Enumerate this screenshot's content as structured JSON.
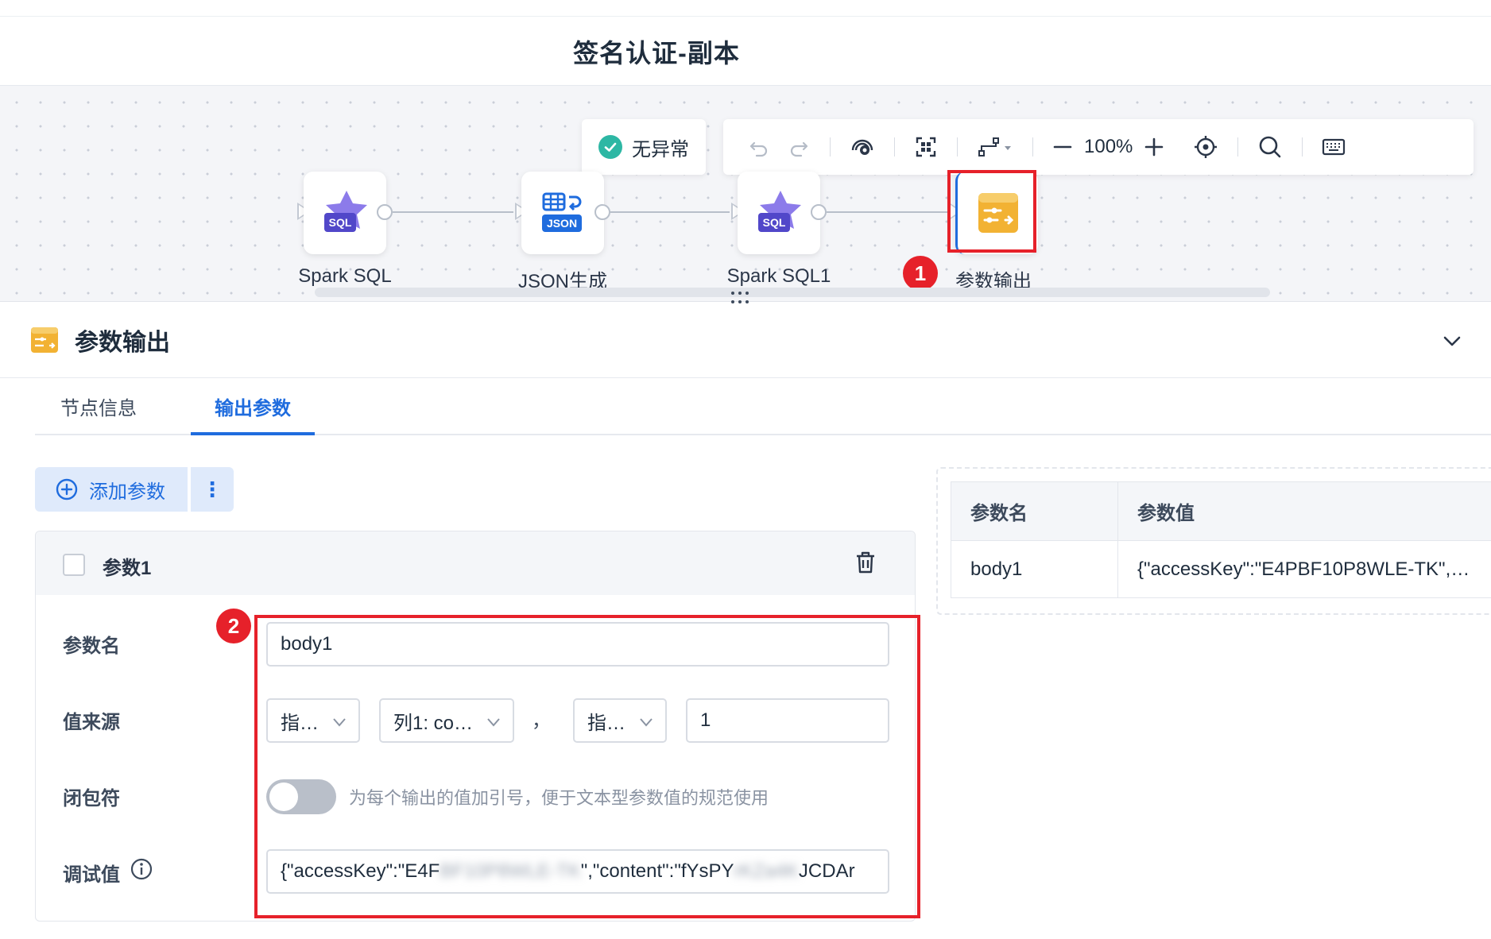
{
  "page": {
    "title": "签名认证-副本"
  },
  "canvas": {
    "status_text": "无异常",
    "zoom": "100%",
    "nodes": [
      {
        "label": "Spark SQL",
        "badge": "SQL"
      },
      {
        "label": "JSON生成",
        "badge": "JSON"
      },
      {
        "label": "Spark SQL1",
        "badge": "SQL"
      },
      {
        "label": "参数输出",
        "badge": ""
      }
    ],
    "annotations": [
      "1",
      "2"
    ]
  },
  "panel": {
    "title": "参数输出",
    "tabs": [
      {
        "label": "节点信息",
        "active": false
      },
      {
        "label": "输出参数",
        "active": true
      }
    ],
    "add_button_label": "添加参数",
    "more_button_label": "⋮",
    "param": {
      "title": "参数1",
      "name_label": "参数名",
      "name_value": "body1",
      "source_label": "值来源",
      "source_select_1": "指…",
      "source_select_2": "列1: co…",
      "source_separator": "，",
      "source_select_3": "指…",
      "source_input": "1",
      "closure_label": "闭包符",
      "closure_hint": "为每个输出的值加引号，便于文本型参数值的规范使用",
      "closure_enabled": false,
      "debug_label": "调试值",
      "debug_prefix": "{\"accessKey\":\"E4F",
      "debug_blur_1": "BF10P8WLE-TK",
      "debug_middle": "\",\"content\":\"fYsPY",
      "debug_blur_2": "rKZa4K",
      "debug_suffix": "JCDAr"
    }
  },
  "table": {
    "headers": [
      "参数名",
      "参数值"
    ],
    "rows": [
      [
        "body1",
        "{\"accessKey\":\"E4PBF10P8WLE-TK\",…"
      ]
    ]
  },
  "colors": {
    "accent": "#1f6cde",
    "highlight": "#e6212a",
    "success": "#2db7a4",
    "node_icon": "#f2b233"
  }
}
